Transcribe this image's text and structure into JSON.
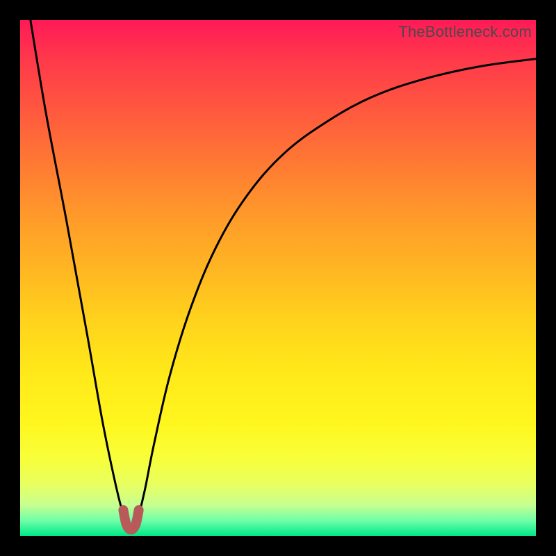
{
  "watermark": "TheBottleneck.com",
  "chart_data": {
    "type": "line",
    "title": "",
    "xlabel": "",
    "ylabel": "",
    "xlim": [
      0,
      100
    ],
    "ylim": [
      0,
      100
    ],
    "grid": false,
    "legend": false,
    "series": [
      {
        "name": "bottleneck-curve",
        "color": "#000000",
        "x": [
          2,
          5,
          9,
          13,
          16,
          18.5,
          20,
          20.8,
          21.5,
          22.2,
          23,
          24.2,
          26,
          29,
          33,
          38,
          44,
          51,
          59,
          68,
          78,
          89,
          100
        ],
        "y": [
          100,
          82,
          61,
          39,
          22,
          10,
          4,
          1.4,
          0.9,
          1.4,
          4,
          9,
          18,
          31,
          44,
          56,
          66,
          74,
          80,
          85,
          88.5,
          91,
          92.5
        ]
      }
    ],
    "marker": {
      "name": "optimal-region",
      "points": [
        {
          "x": 20.0,
          "y": 5.0
        },
        {
          "x": 20.6,
          "y": 2.2
        },
        {
          "x": 21.5,
          "y": 1.2
        },
        {
          "x": 22.4,
          "y": 2.2
        },
        {
          "x": 23.0,
          "y": 5.0
        }
      ],
      "color": "#b85a5a"
    }
  }
}
